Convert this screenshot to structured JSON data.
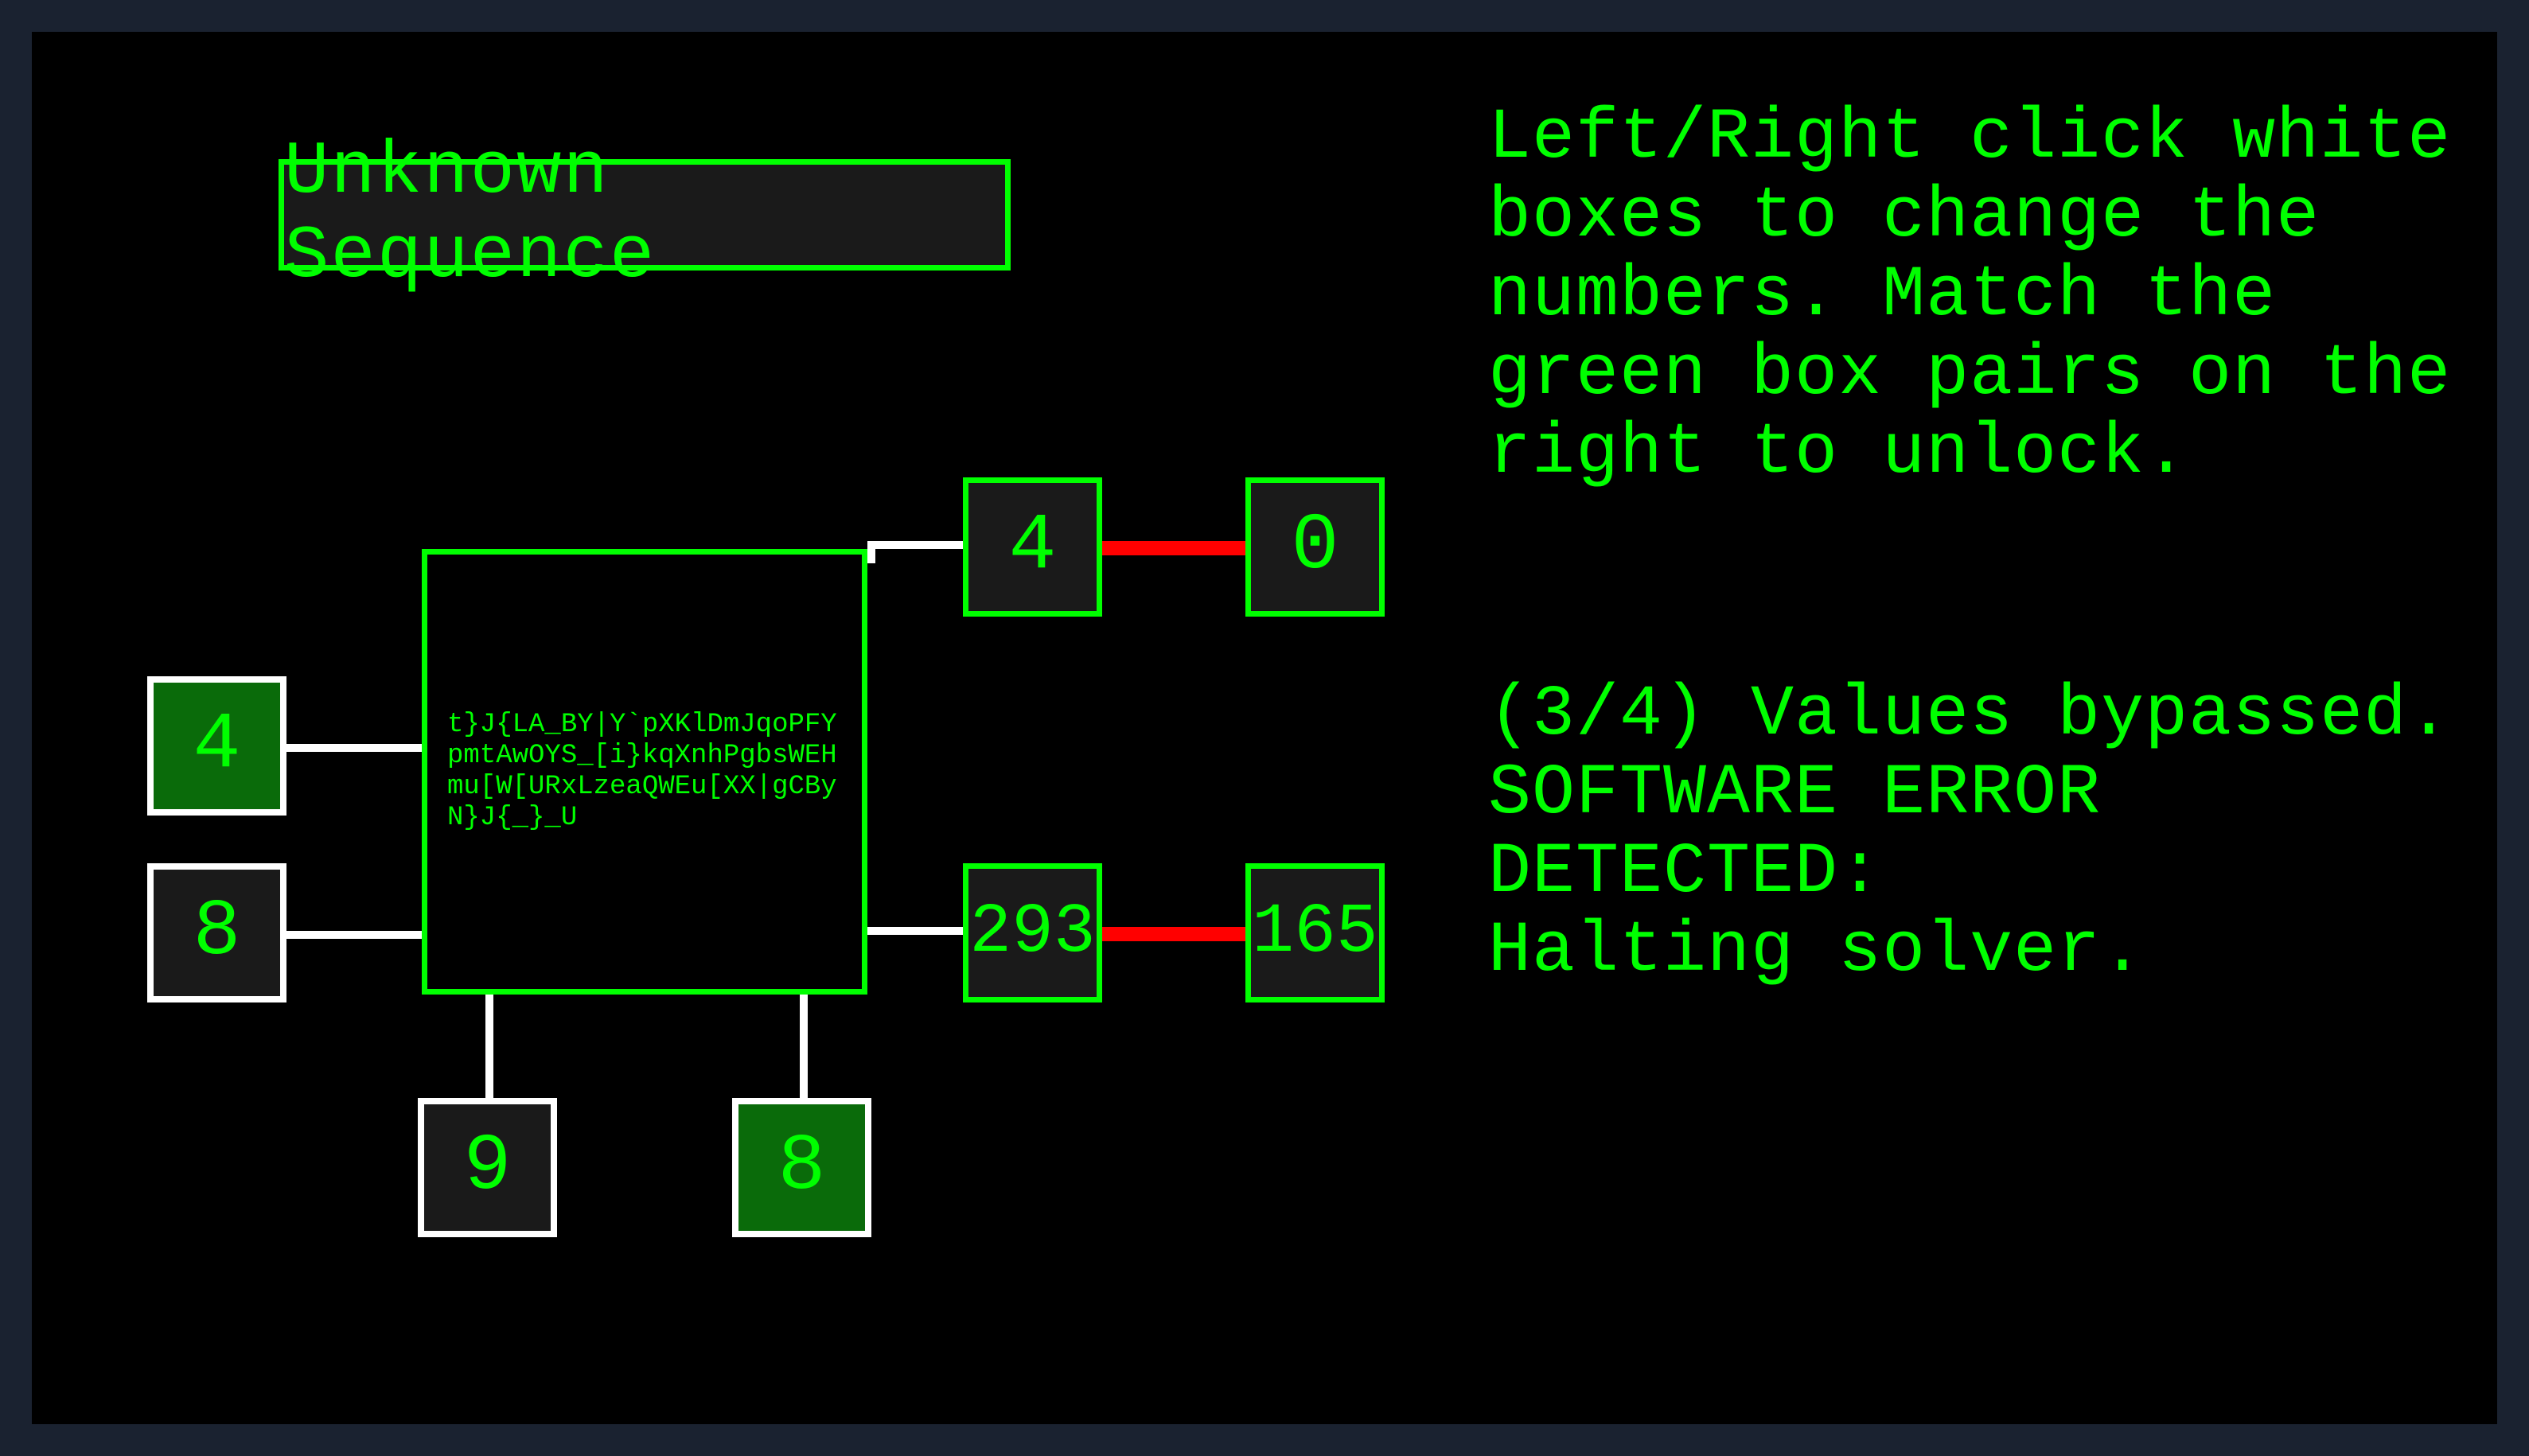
{
  "title": "Unknown Sequence",
  "cipher_text": "t}J{LA_BY|Y`pXKlDmJqoPFYpmtAwOYS_[i}kqXnhPgbsWEHmu[W[URxLzeaQWEu[XX|gCByN}J{_}_U",
  "inputs": {
    "left_1": "4",
    "left_2": "8",
    "bottom_1": "9",
    "bottom_2": "8"
  },
  "outputs": {
    "right_1_computed": "4",
    "right_1_target": "0",
    "right_2_computed": "293",
    "right_2_target": "165"
  },
  "instructions": "Left/Right click white boxes to change the numbers. Match the green box pairs on the right to unlock.",
  "status": "(3/4) Values bypassed.\nSOFTWARE ERROR DETECTED:\nHalting solver.",
  "colors": {
    "accent": "#00ff00",
    "error": "#ff0000",
    "input_border": "#ffffff",
    "panel_bg": "#000000",
    "outer_bg": "#1a2230"
  }
}
